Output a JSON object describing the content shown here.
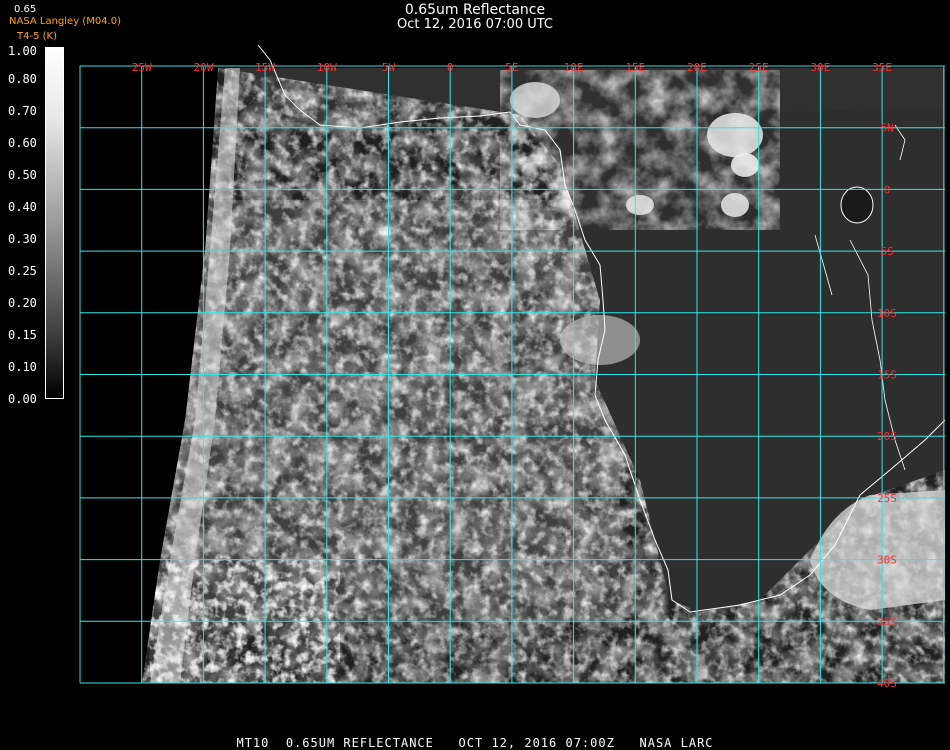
{
  "header": {
    "title": "0.65um Reflectance",
    "subtitle": "Oct 12, 2016 07:00 UTC",
    "org": "NASA Langley (M04.0)",
    "channel": "T4-5 (K)",
    "colorbar_top_label": "0.65"
  },
  "colorbar": {
    "ticks": [
      "1.00",
      "0.80",
      "0.70",
      "0.60",
      "0.50",
      "0.40",
      "0.30",
      "0.25",
      "0.20",
      "0.15",
      "0.10",
      "0.00"
    ]
  },
  "map": {
    "lon_labels": [
      "25W",
      "20W",
      "15W",
      "10W",
      "5W",
      "0",
      "5E",
      "10E",
      "15E",
      "20E",
      "25E",
      "30E",
      "35E"
    ],
    "lat_labels": [
      "5N",
      "0",
      "5S",
      "10S",
      "15S",
      "20S",
      "25S",
      "30S",
      "35S",
      "40S"
    ],
    "grid_color": "#33e5e5",
    "label_color": "#ff3030"
  },
  "footer": {
    "text": "MT10  0.65UM REFLECTANCE   OCT 12, 2016 07:00Z   NASA LARC"
  }
}
